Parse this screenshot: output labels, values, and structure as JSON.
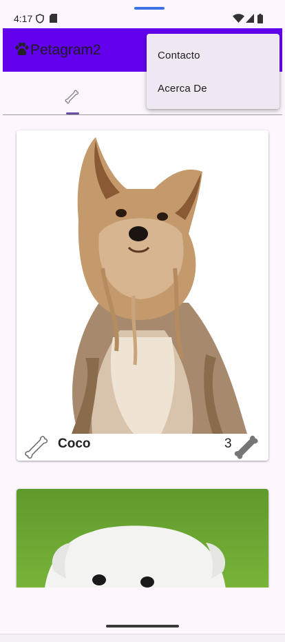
{
  "status_bar": {
    "time": "4:17",
    "icons": [
      "shield-icon",
      "sd-card-icon",
      "wifi-icon",
      "signal-icon",
      "battery-icon"
    ]
  },
  "app_bar": {
    "title": "Petagram2",
    "logo_icon": "paw-icon",
    "color": "#6200ee"
  },
  "tabs": [
    {
      "icon": "bone-icon",
      "selected": true
    }
  ],
  "overflow_menu": {
    "items": [
      {
        "label": "Contacto"
      },
      {
        "label": "Acerca De"
      }
    ]
  },
  "pets": [
    {
      "name": "Coco",
      "likes": "3",
      "photo": "yorkshire-terrier-photo"
    },
    {
      "name": "",
      "likes": "",
      "photo": "white-dog-photo"
    }
  ],
  "colors": {
    "accent": "#6200ee",
    "tab_indicator": "#6750a4",
    "background": "#fdf7fd",
    "menu_background": "#efe8f2"
  }
}
